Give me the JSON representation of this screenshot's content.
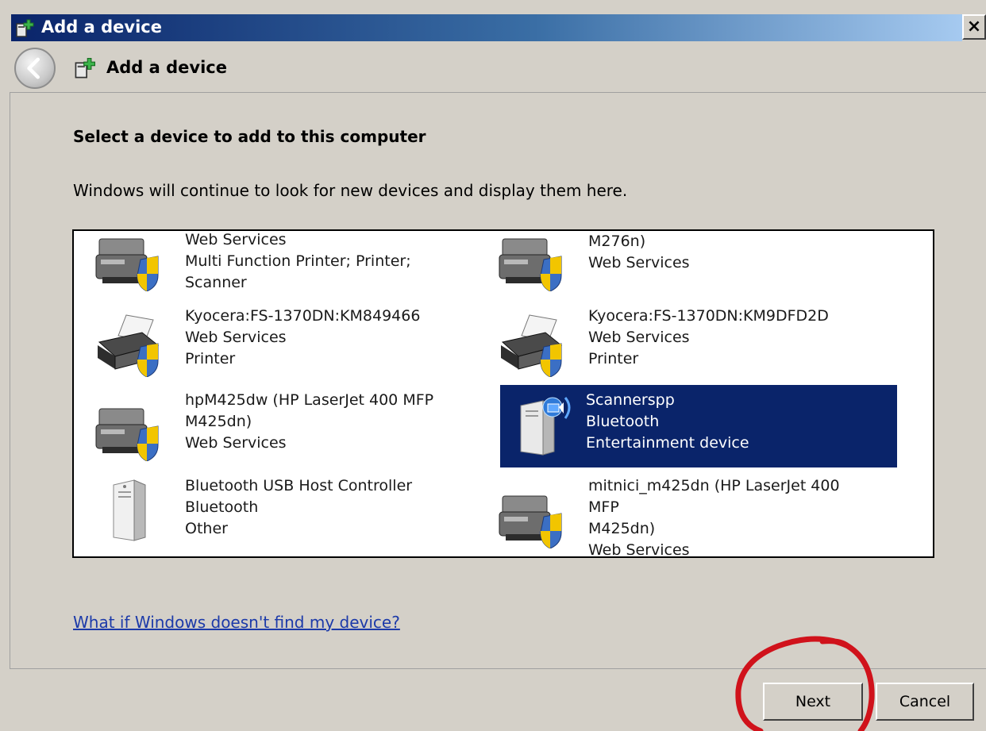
{
  "window": {
    "title": "Add a device",
    "close_glyph": "×"
  },
  "header": {
    "title": "Add a device",
    "back_icon": "back-arrow-icon"
  },
  "page": {
    "heading": "Select a device to add to this computer",
    "description": "Windows will continue to look for new devices and display them here."
  },
  "devices": [
    {
      "icon": "mfp-printer-icon",
      "lines": "Web Services\nMulti Function Printer; Printer; Scanner",
      "selected": false
    },
    {
      "icon": "mfp-printer-icon",
      "lines": "M276n)\nWeb Services",
      "selected": false
    },
    {
      "icon": "printer-icon",
      "lines": "Kyocera:FS-1370DN:KM849466\nWeb Services\nPrinter",
      "selected": false
    },
    {
      "icon": "printer-icon",
      "lines": "Kyocera:FS-1370DN:KM9DFD2D\nWeb Services\nPrinter",
      "selected": false
    },
    {
      "icon": "mfp-printer-icon",
      "lines": "hpM425dw (HP LaserJet 400 MFP\nM425dn)\nWeb Services",
      "selected": false
    },
    {
      "icon": "media-device-icon",
      "lines": "Scannerspp\nBluetooth\nEntertainment device",
      "selected": true
    },
    {
      "icon": "pc-tower-icon",
      "lines": "Bluetooth USB Host Controller\nBluetooth\nOther",
      "selected": false
    },
    {
      "icon": "mfp-printer-icon",
      "lines": "mitnici_m425dn (HP LaserJet 400 MFP\nM425dn)\nWeb Services",
      "selected": false
    }
  ],
  "links": {
    "help": "What if Windows doesn't find my device?"
  },
  "buttons": {
    "next": "Next",
    "cancel": "Cancel"
  },
  "colors": {
    "selection": "#0a246a",
    "link": "#1c3aa9",
    "annotation": "#d0121b"
  }
}
